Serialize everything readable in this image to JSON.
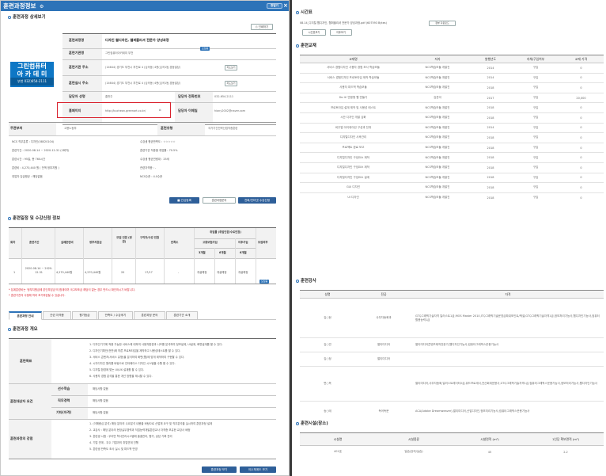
{
  "window": {
    "title": "훈련과정정보",
    "view_button": "창닫기"
  },
  "detail": {
    "title": "훈련과정 상세보기",
    "print_button": "인쇄하기",
    "logo": {
      "line1": "그린컴퓨터",
      "line2": "아 카 데 미",
      "phone": "부천 032)654-2111"
    },
    "rows": [
      {
        "label": "훈련과정명",
        "value": "디자인 웹디자인, 웹퍼블리셔 전문가 양성과정",
        "badge": "모집중"
      },
      {
        "label": "훈련기관명",
        "value": "그린컴퓨터아카데미 부천"
      },
      {
        "label": "훈련기관 주소",
        "value": "(14644) 경기도 부천시 부천로 4 (심곡동) 4층(심곡1동,경동빌딩)",
        "button": "지도보기"
      },
      {
        "label": "훈련실시 주소",
        "value": "(14644) 경기도 부천시 부천로 4 (심곡동) 4층(심곡1동,경동빌딩)",
        "button": "지도보기"
      },
      {
        "label": "담당자 성명",
        "value": "홍판주",
        "label2": "담당자 전화번호",
        "value2": "032-654-2111"
      },
      {
        "label": "홈페이지",
        "value": "http://bucheon.greenart.co.kr/",
        "label2": "담당자 이메일",
        "value2": "hiony2002@naver.com"
      }
    ],
    "extra": [
      {
        "label": "주관부처",
        "value": "고용노동부",
        "label2": "훈련유형",
        "value2": "국가기간전략산업직종훈련"
      }
    ],
    "info_left": [
      "NCS 직무분류 : 디자인(08020104)",
      "훈련기간 : 2020-08-14 ~ 2020-12-31 (1회차)",
      "훈련시간 : 95일, 총 760시간",
      "훈련비 : 4,270,440 원 ( 전액 정부지원 )",
      "취업자 임금평균 : 해당없음"
    ],
    "info_right": [
      "수강생 평균만족도 : ☆☆☆☆☆",
      "훈련기관 직종별 취업률 : 70.5%",
      "수강생 평균연령대 : 25세",
      "관련자격증 : -",
      "NCS수준 : 4.0수준"
    ],
    "buttons": {
      "favorite": "관심등록",
      "inquiry": "훈련과정문의",
      "apply": "전화/인터넷 수강신청"
    }
  },
  "schedule": {
    "title": "훈련일정 및 수강신청 정보",
    "headers": [
      "회차",
      "훈련기간",
      "실제훈련비",
      "정부지원금",
      "모집 인원 (정원)",
      "구직자/수강 인원",
      "만족도",
      "취업률 (취업인원/수료인원)",
      "모집여부"
    ],
    "sub_headers": {
      "employ": "고용보험가입",
      "later": "이후가입",
      "m3": "3개월",
      "m6": "6개월",
      "m6b": "6개월"
    },
    "row": {
      "no": "1",
      "period": "2020-08-14 ~ 2020-12-31",
      "cost": "4,270,440원",
      "support": "4,270,440원",
      "quota": "20",
      "apply": "17/17",
      "satisfaction": "-",
      "e1": "개설예정",
      "e2": "개설예정",
      "e3": "개설예정",
      "status": "모집중"
    },
    "notes": [
      "* 집계훈련비는 '정부지원금에 본인부담금'의 합계이며 국고보조금 해당이 없는 경우 반드시 확인하시기 바랍니다.",
      "* 훈련기관의 사정에 따라 조기마감될 수 있습니다."
    ]
  },
  "tabs": [
    "훈련과정 안내",
    "관련 자격증",
    "평가등급",
    "만족도 / 수강후기",
    "훈련과정 문의",
    "훈련기관 소개"
  ],
  "overview": {
    "title": "훈련과정 개요",
    "goal_label": "훈련목표",
    "goal_lines": [
      "1. 디자인기기에 적용 가능한 서비스에 대하여 사용자환경과 니즈를 분석하여 정보설계, UI설계, 화면설계를 할 수 있다.",
      "2. 디자인기획안(전반)에 따른 프로토타입을 제작하고 사용성테스트를 할 수 있다.",
      "3. 서비스 콘텐츠(서비스 유형)을 분석하여 화면(웹)에 맞게 제작하여 구현할 수 있다.",
      "4. 시각디자인 원리를 바탕으로 인터페이스 디자인 시스템을 수행 할 수 있다.",
      "5. 디지털 환경에 맞는 UI/UX 설계를 할 수 있다.",
      "6. 사용자 경험 분석을 통한 개선 방향을 제시할 수 있다."
    ],
    "req_label": "훈련대상자 요건",
    "req": [
      {
        "label": "선수학습",
        "value": "해당사항 없음"
      },
      {
        "label": "직무경력",
        "value": "해당사항 없음"
      },
      {
        "label": "기타(자격)",
        "value": "해당사항 없음"
      }
    ],
    "strength_label": "훈련과정의 강점",
    "strength_lines": [
      "1. (이해중심 분석) 해당 분야의 수요분석 내용을 바탕으로 산업체 요구 및 직무분석을 실시하여 훈련과정 설계",
      "2. 교강사 : 해당 분야의 현장실무경력과 직업능력개발훈련교사 자격증 보유한 교강사 배정",
      "3. 훈련생 시험 : 우리반 학사관리시스템에 출결관리, 평가, 상담 기록 관리",
      "4. 기업 연계 - 우수 기업과의 취업연계 진행",
      "5. 훈련생 만족도 조사 실시 및 피드백 반영"
    ],
    "buttons": {
      "guide": "훈련과정 보기",
      "training": "이수체계도 보기"
    }
  },
  "right": {
    "timetable": {
      "title": "시간표",
      "file": "08.14_디지털 웹디자인, 웹퍼블리셔 전문가 양성과정.pdf (607593 Bytes)",
      "file_btn": "첨부 다운로드",
      "btn1": "시간표보기",
      "btn2": "이후보기"
    },
    "books": {
      "title": "훈련교재",
      "headers": [
        "교재명",
        "저자",
        "발행년도",
        "자체/구입여부",
        "교재 가격"
      ],
      "rows": [
        [
          "서비스 경험디자인 사용자 경험 조사 학습모듈",
          "NCS학습모듈 개발진",
          "2014",
          "구입",
          "0"
        ],
        [
          "서비스 경험디자인 프로토타입 제작 학습모듈",
          "NCS학습모듈 개발진",
          "2014",
          "구입",
          "0"
        ],
        [
          "사용자 피드백 학습모듈",
          "NCS학습모듈 개발진",
          "2018",
          "구입",
          "0"
        ],
        [
          "Do it! 반응형 웹 만들기",
          "김운아",
          "2017",
          "구입",
          "20,000"
        ],
        [
          "프로토타입 설계 제작 및 사용성 테스트",
          "NCS학습모듈 개발진",
          "2018",
          "구입",
          "0"
        ],
        [
          "시안 디자인 개발 심화",
          "NCS학습모듈 개발진",
          "2018",
          "구입",
          "0"
        ],
        [
          "비주얼 아이데이션 구성과 전개",
          "NCS학습모듈 개발진",
          "2014",
          "구입",
          "0"
        ],
        [
          "디지털디자인 사후관리",
          "NCS학습모듈 개발진",
          "2018",
          "구입",
          "0"
        ],
        [
          "프로젝트 완료 보고",
          "NCS학습모듈 개발진",
          "2018",
          "구입",
          "0"
        ],
        [
          "디지털디자인 구성요소 제작",
          "NCS학습모듈 개발진",
          "2018",
          "구입",
          "0"
        ],
        [
          "디지털디자인 구성요소 제작",
          "NCS학습모듈 개발진",
          "2018",
          "구입",
          "0"
        ],
        [
          "디지털디자인 구성요소 설계",
          "NCS학습모듈 개발진",
          "2018",
          "구입",
          "0"
        ],
        [
          "GUI 디자인",
          "NCS학습모듈 개발진",
          "2018",
          "구입",
          "0"
        ],
        [
          "UI 디자인",
          "NCS학습모듈 개발진",
          "2018",
          "구입",
          "0"
        ]
      ]
    },
    "teachers": {
      "title": "훈련강사",
      "headers": [
        "성명",
        "전공",
        "자격"
      ],
      "rows": [
        [
          "김○현",
          "사무자동화과",
          "GTQ그래픽기술자격 일러스트1급,MOS Master 2010,ITQ그래픽기술운영급파워포인트/엑셀,GTQ그래픽기술자격1급,정보처리기능사,웹디자인기능사,컴퓨터활용능력1급"
        ],
        [
          "김○연",
          "멀티미디어",
          "멀티미디어콘텐츠제작전문가,웹디자인기능사,컴퓨터그래픽스운용기능사"
        ],
        [
          "김○정",
          "멀티미디어",
          ""
        ],
        [
          "변○옥",
          "",
          "멀티미디어,사무자동화,일러스트레이터2급,워드프로세서,전산회계운용사,GTQ그래픽기술자격1급,컴퓨터그래픽스운용기능사,정보처리기능사,웹디자인기능사"
        ],
        [
          "송○태",
          "독어독문",
          "ACA(Adobe Dreamweaver),멀티미디어,산업디자인,정보처리기능사,컴퓨터그래픽스운용기능사"
        ]
      ]
    },
    "facilities": {
      "title": "훈련시설(장소)",
      "headers": [
        "시설명",
        "시설종류",
        "시설면적 (m²)",
        "1인당 확보면적 (m²)"
      ],
      "rows": [
        [
          "401호",
          "일습(강의/실습)",
          "45",
          "2.2"
        ]
      ]
    }
  },
  "colors": {
    "primary": "#2d73b8",
    "highlight": "#d9232f",
    "apply_btn": "#2e5f99"
  }
}
